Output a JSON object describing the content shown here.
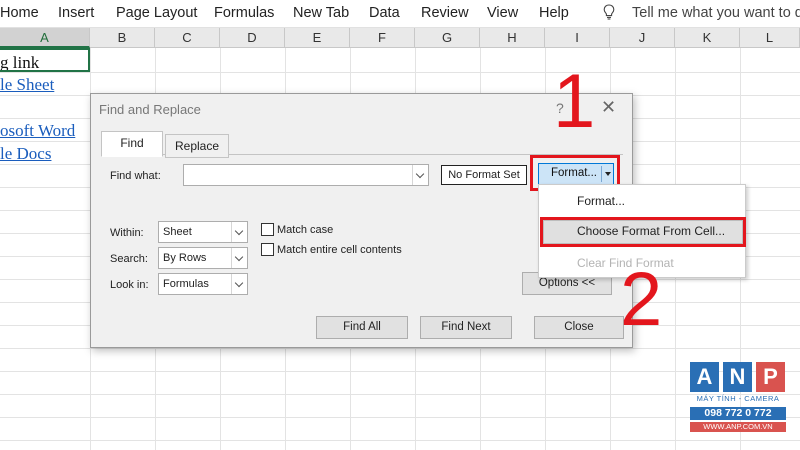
{
  "ribbon": {
    "tabs": [
      "Home",
      "Insert",
      "Page Layout",
      "Formulas",
      "New Tab",
      "Data",
      "Review",
      "View",
      "Help"
    ],
    "tell_me": "Tell me what you want to d"
  },
  "sheet": {
    "columns": [
      "A",
      "B",
      "C",
      "D",
      "E",
      "F",
      "G",
      "H",
      "I",
      "J",
      "K",
      "L"
    ],
    "cells": [
      "g link",
      "le Sheet",
      "osoft Word",
      "le Docs"
    ]
  },
  "dialog": {
    "title": "Find and Replace",
    "help": "?",
    "close": "✕",
    "tabs": {
      "find": "Find",
      "replace": "Replace"
    },
    "find_what_label": "Find what:",
    "find_what_value": "",
    "no_format_set": "No Format Set",
    "format_button": "Format...",
    "within_label": "Within:",
    "within_value": "Sheet",
    "search_label": "Search:",
    "search_value": "By Rows",
    "look_in_label": "Look in:",
    "look_in_value": "Formulas",
    "match_case": "Match case",
    "match_entire": "Match entire cell contents",
    "options_button": "Options <<",
    "find_all": "Find All",
    "find_next": "Find Next",
    "close_button": "Close"
  },
  "menu": {
    "items": [
      "Format...",
      "Choose Format From Cell...",
      "Clear Find Format"
    ]
  },
  "annotations": {
    "step1": "1",
    "step2": "2"
  },
  "logo": {
    "letters": [
      "A",
      "N",
      "P"
    ],
    "caption": "MÁY TÍNH - CAMERA",
    "phone": "098 772 0 772",
    "website": "WWW.ANP.COM.VN"
  },
  "colors": {
    "highlight_red": "#e3161d",
    "excel_green": "#217346",
    "link_blue": "#1a5dbd"
  }
}
